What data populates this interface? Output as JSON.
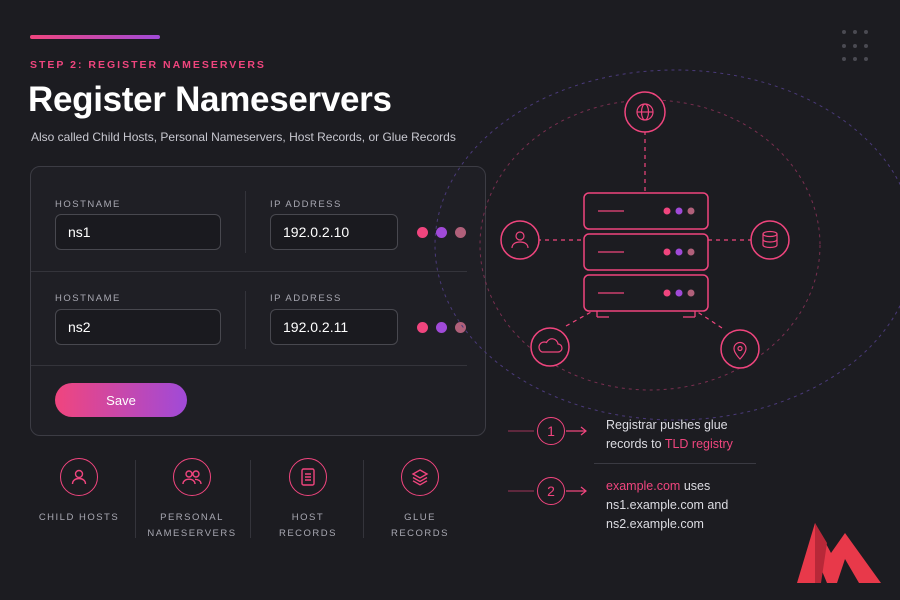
{
  "header": {
    "step_label": "STEP 2: REGISTER NAMESERVERS",
    "title": "Register Nameservers",
    "subtitle": "Also called Child Hosts, Personal Nameservers, Host Records, or Glue Records"
  },
  "form": {
    "rows": [
      {
        "hostname_label": "HOSTNAME",
        "hostname_value": "ns1",
        "ip_label": "IP ADDRESS",
        "ip_value": "192.0.2.10"
      },
      {
        "hostname_label": "HOSTNAME",
        "hostname_value": "ns2",
        "ip_label": "IP ADDRESS",
        "ip_value": "192.0.2.11"
      }
    ],
    "save_label": "Save"
  },
  "features": [
    {
      "icon": "user-icon",
      "line1": "CHILD HOSTS",
      "line2": ""
    },
    {
      "icon": "users-icon",
      "line1": "PERSONAL",
      "line2": "NAMESERVERS"
    },
    {
      "icon": "document-icon",
      "line1": "HOST",
      "line2": "RECORDS"
    },
    {
      "icon": "layers-icon",
      "line1": "GLUE",
      "line2": "RECORDS"
    }
  ],
  "notes": [
    {
      "number": "1",
      "text_plain": "Registrar pushes glue",
      "text_plain2": "records to ",
      "text_highlight": "TLD registry"
    },
    {
      "number": "2",
      "text_highlight": "example.com",
      "text_plain": " uses",
      "line2": "ns1.example.com and",
      "line3": "ns2.example.com"
    }
  ],
  "diagram_icons": [
    "globe-icon",
    "user-icon",
    "database-icon",
    "cloud-icon",
    "location-pin-icon",
    "server-icon"
  ],
  "colors": {
    "background": "#1c1c21",
    "accent_pink": "#f0457e",
    "accent_purple": "#a04ad8",
    "dot_muted": "#b0607a"
  }
}
